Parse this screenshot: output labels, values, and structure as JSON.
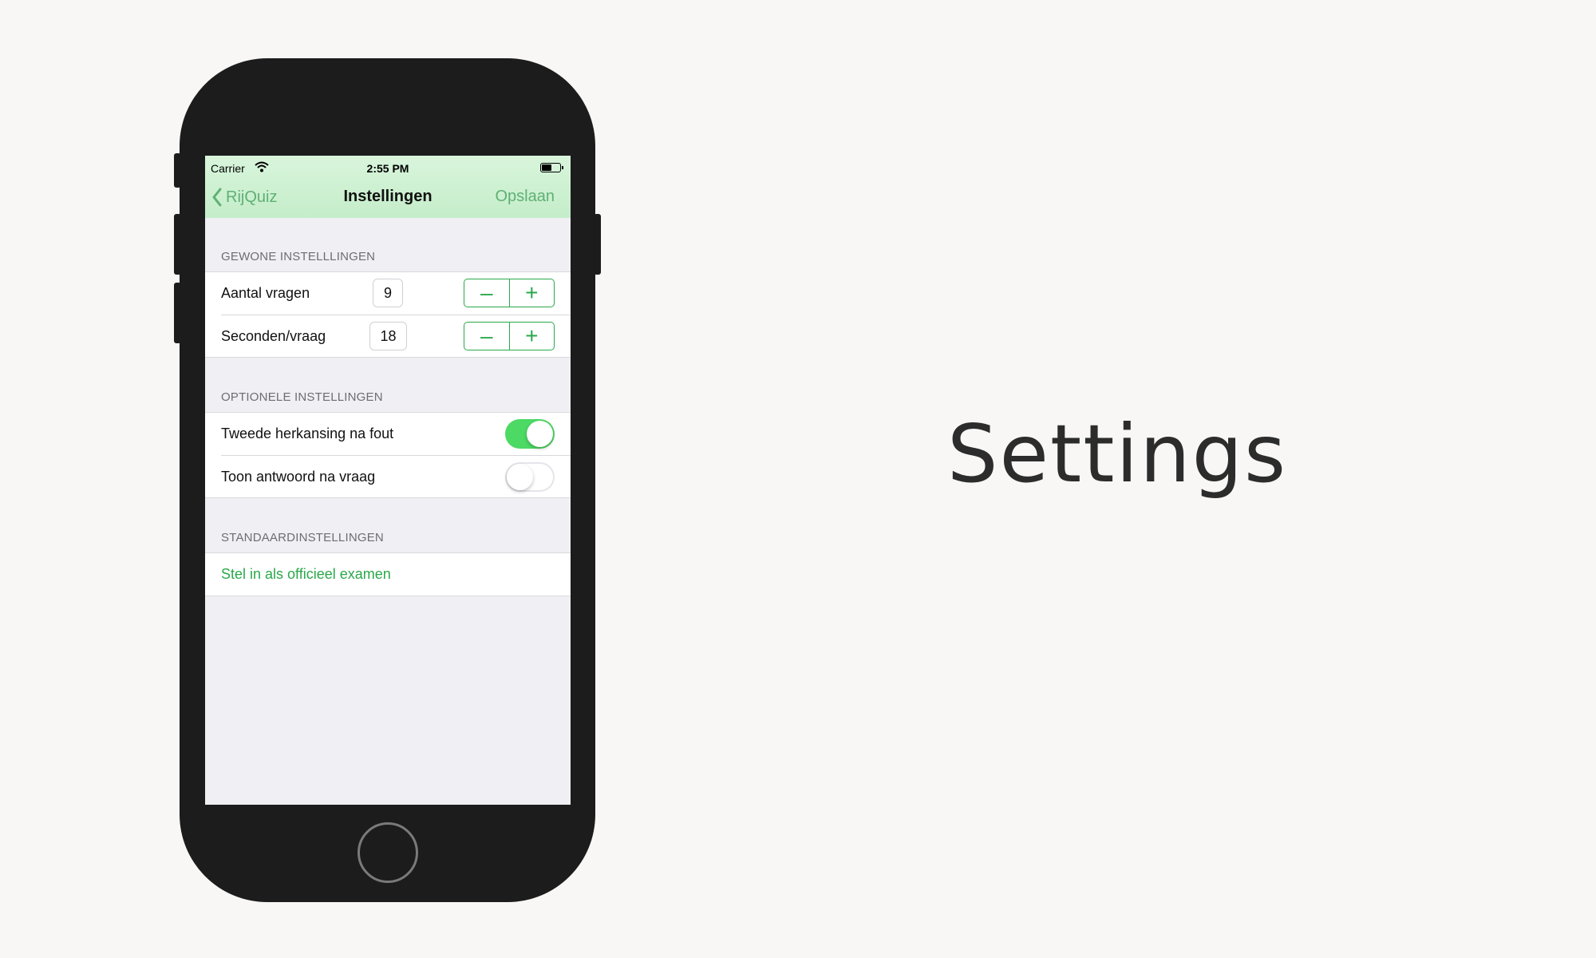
{
  "status_bar": {
    "carrier": "Carrier",
    "time": "2:55 PM"
  },
  "nav": {
    "back_label": "RijQuiz",
    "title": "Instellingen",
    "save_label": "Opslaan"
  },
  "sections": {
    "general": {
      "header": "GEWONE INSTELLLINGEN",
      "rows": [
        {
          "label": "Aantal vragen",
          "value": "9",
          "minus": "–",
          "plus": "+"
        },
        {
          "label": "Seconden/vraag",
          "value": "18",
          "minus": "–",
          "plus": "+"
        }
      ]
    },
    "optional": {
      "header": "OPTIONELE INSTELLINGEN",
      "rows": [
        {
          "label": "Tweede herkansing na fout",
          "on": true
        },
        {
          "label": "Toon antwoord na vraag",
          "on": false
        }
      ]
    },
    "defaults": {
      "header": "STANDAARDINSTELLINGEN",
      "action_label": "Stel in als officieel examen"
    }
  },
  "headline": "Settings",
  "colors": {
    "accent": "#2aa84a",
    "nav_gradient_top": "#d9f5dc",
    "toggle_on": "#4cd964"
  }
}
